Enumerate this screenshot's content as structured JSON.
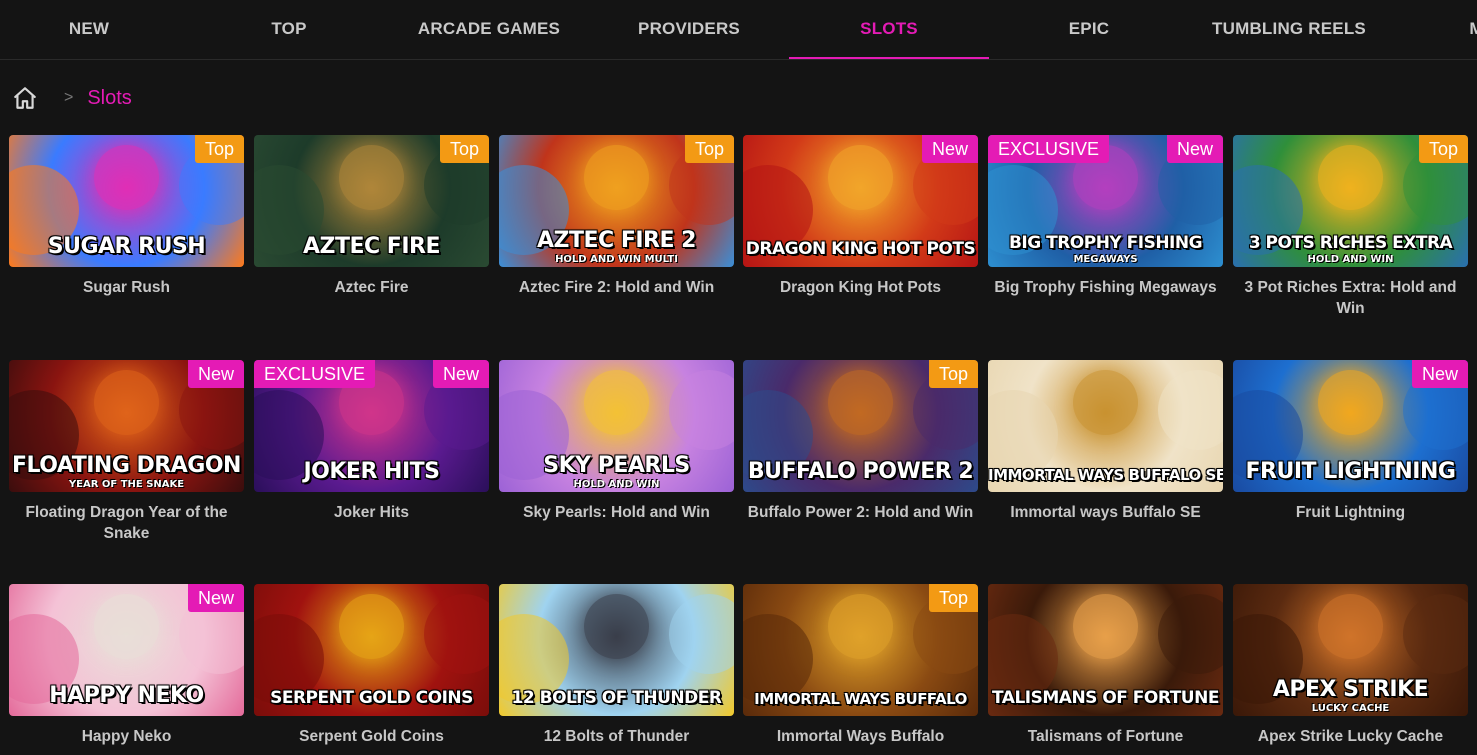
{
  "nav": {
    "tabs": [
      {
        "label": "NEW"
      },
      {
        "label": "TOP"
      },
      {
        "label": "ARCADE GAMES"
      },
      {
        "label": "PROVIDERS"
      },
      {
        "label": "SLOTS"
      },
      {
        "label": "EPIC"
      },
      {
        "label": "TUMBLING REELS"
      },
      {
        "label": "MEG"
      }
    ],
    "active_tab": "SLOTS",
    "accent_color": "#e41bb5"
  },
  "breadcrumb": {
    "home_icon": "home-icon",
    "separator": ">",
    "current": "Slots"
  },
  "badge_colors": {
    "Top": "#f39a14",
    "New": "#e41bb5",
    "EXCLUSIVE": "#e41bb5"
  },
  "games": [
    {
      "name": "Sugar Rush",
      "art_title": "SUGAR RUSH",
      "art_sub": "",
      "badge_right": "Top",
      "badge_left": "",
      "bg": [
        "#3a7bff",
        "#e02fb5",
        "#ff7a1a"
      ]
    },
    {
      "name": "Aztec Fire",
      "art_title": "AZTEC FIRE",
      "art_sub": "",
      "badge_right": "Top",
      "badge_left": "",
      "bg": [
        "#1d3b2a",
        "#b0863a",
        "#2a4a32"
      ]
    },
    {
      "name": "Aztec Fire 2: Hold and Win",
      "art_title": "AZTEC FIRE 2",
      "art_sub": "HOLD AND WIN MULTI",
      "badge_right": "Top",
      "badge_left": "",
      "bg": [
        "#c0341b",
        "#f0a11f",
        "#3a8fd8"
      ]
    },
    {
      "name": "Dragon King Hot Pots",
      "art_title": "DRAGON KING HOT POTS",
      "art_sub": "",
      "badge_right": "New",
      "badge_left": "",
      "bg": [
        "#d23a18",
        "#f2a62a",
        "#b51414"
      ]
    },
    {
      "name": "Big Trophy Fishing Megaways",
      "art_title": "BIG TROPHY FISHING",
      "art_sub": "MEGAWAYS",
      "badge_right": "New",
      "badge_left": "EXCLUSIVE",
      "bg": [
        "#1f5fa6",
        "#b43fbf",
        "#2d8fd0"
      ]
    },
    {
      "name": "3 Pot Riches Extra: Hold and Win",
      "art_title": "3 POTS RICHES EXTRA",
      "art_sub": "HOLD AND WIN",
      "badge_right": "Top",
      "badge_left": "",
      "bg": [
        "#2f8f3a",
        "#f0b21e",
        "#2a6fb0"
      ]
    },
    {
      "name": "Floating Dragon Year of the Snake",
      "art_title": "FLOATING DRAGON",
      "art_sub": "YEAR OF THE SNAKE",
      "badge_right": "New",
      "badge_left": "",
      "bg": [
        "#8a1410",
        "#e0641a",
        "#3a0d0d"
      ]
    },
    {
      "name": "Joker Hits",
      "art_title": "JOKER HITS",
      "art_sub": "",
      "badge_right": "New",
      "badge_left": "EXCLUSIVE",
      "bg": [
        "#5a1a8f",
        "#d1358a",
        "#2a0f5a"
      ]
    },
    {
      "name": "Sky Pearls: Hold and Win",
      "art_title": "SKY PEARLS",
      "art_sub": "HOLD AND WIN",
      "badge_right": "",
      "badge_left": "",
      "bg": [
        "#c782e0",
        "#f4c235",
        "#9c62d6"
      ]
    },
    {
      "name": "Buffalo Power 2: Hold and Win",
      "art_title": "BUFFALO POWER 2",
      "art_sub": "",
      "badge_right": "Top",
      "badge_left": "",
      "bg": [
        "#4a2a6a",
        "#c26a22",
        "#2d4a8a"
      ]
    },
    {
      "name": "Immortal ways Buffalo SE",
      "art_title": "IMMORTAL WAYS BUFFALO SE",
      "art_sub": "",
      "badge_right": "",
      "badge_left": "",
      "bg": [
        "#f0e3c8",
        "#c99230",
        "#e8d6b0"
      ]
    },
    {
      "name": "Fruit Lightning",
      "art_title": "FRUIT LIGHTNING",
      "art_sub": "",
      "badge_right": "New",
      "badge_left": "",
      "bg": [
        "#1d6fd0",
        "#f2a81e",
        "#1a4aa0"
      ]
    },
    {
      "name": "Happy Neko",
      "art_title": "HAPPY NEKO",
      "art_sub": "",
      "badge_right": "New",
      "badge_left": "",
      "bg": [
        "#f4c2d6",
        "#e9dfd8",
        "#e46a9a"
      ]
    },
    {
      "name": "Serpent Gold Coins",
      "art_title": "SERPENT GOLD COINS",
      "art_sub": "",
      "badge_right": "",
      "badge_left": "",
      "bg": [
        "#a0120f",
        "#e6a516",
        "#7a0d0a"
      ]
    },
    {
      "name": "12 Bolts of Thunder",
      "art_title": "12 BOLTS OF THUNDER",
      "art_sub": "",
      "badge_right": "",
      "badge_left": "",
      "bg": [
        "#9fd3f0",
        "#3a3e4a",
        "#f2c92a"
      ]
    },
    {
      "name": "Immortal Ways Buffalo",
      "art_title": "IMMORTAL WAYS BUFFALO",
      "art_sub": "",
      "badge_right": "Top",
      "badge_left": "",
      "bg": [
        "#8a4a12",
        "#e0a22a",
        "#5a2a0a"
      ]
    },
    {
      "name": "Talismans of Fortune",
      "art_title": "TALISMANS OF FORTUNE",
      "art_sub": "",
      "badge_right": "",
      "badge_left": "",
      "bg": [
        "#3a1a0a",
        "#e8a04a",
        "#6a2a10"
      ]
    },
    {
      "name": "Apex Strike Lucky Cache",
      "art_title": "APEX STRIKE",
      "art_sub": "LUCKY CACHE",
      "badge_right": "",
      "badge_left": "",
      "bg": [
        "#5a2a10",
        "#d0742a",
        "#3a1808"
      ]
    }
  ]
}
